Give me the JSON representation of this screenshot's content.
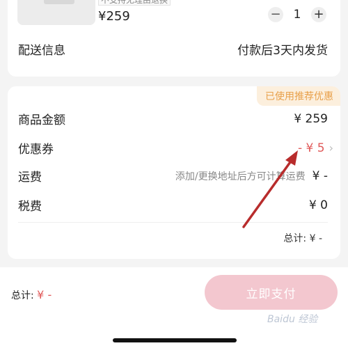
{
  "product": {
    "tag": "不支持无理由退换",
    "price": "¥259",
    "quantity": "1",
    "minus": "−",
    "plus": "+"
  },
  "delivery": {
    "label": "配送信息",
    "value": "付款后3天内发货"
  },
  "summary": {
    "badge": "已使用推荐优惠",
    "goods_label": "商品金额",
    "goods_value": "¥ 259",
    "coupon_label": "优惠券",
    "coupon_value": "- ¥ 5",
    "shipping_label": "运费",
    "shipping_hint": "添加/更换地址后方可计算运费",
    "shipping_value": "¥ -",
    "tax_label": "税费",
    "tax_value": "¥ 0",
    "total_line": "总计: ¥ -"
  },
  "footer": {
    "total_label": "总计:",
    "total_value": "¥ -",
    "pay_label": "立即支付"
  },
  "watermark": "Baidu 经验",
  "colors": {
    "accent_red": "#e05a5a",
    "badge_bg": "#fcefdd",
    "badge_text": "#e8a04a",
    "pay_button": "#f3c7cf",
    "arrow": "#b82c2c"
  }
}
